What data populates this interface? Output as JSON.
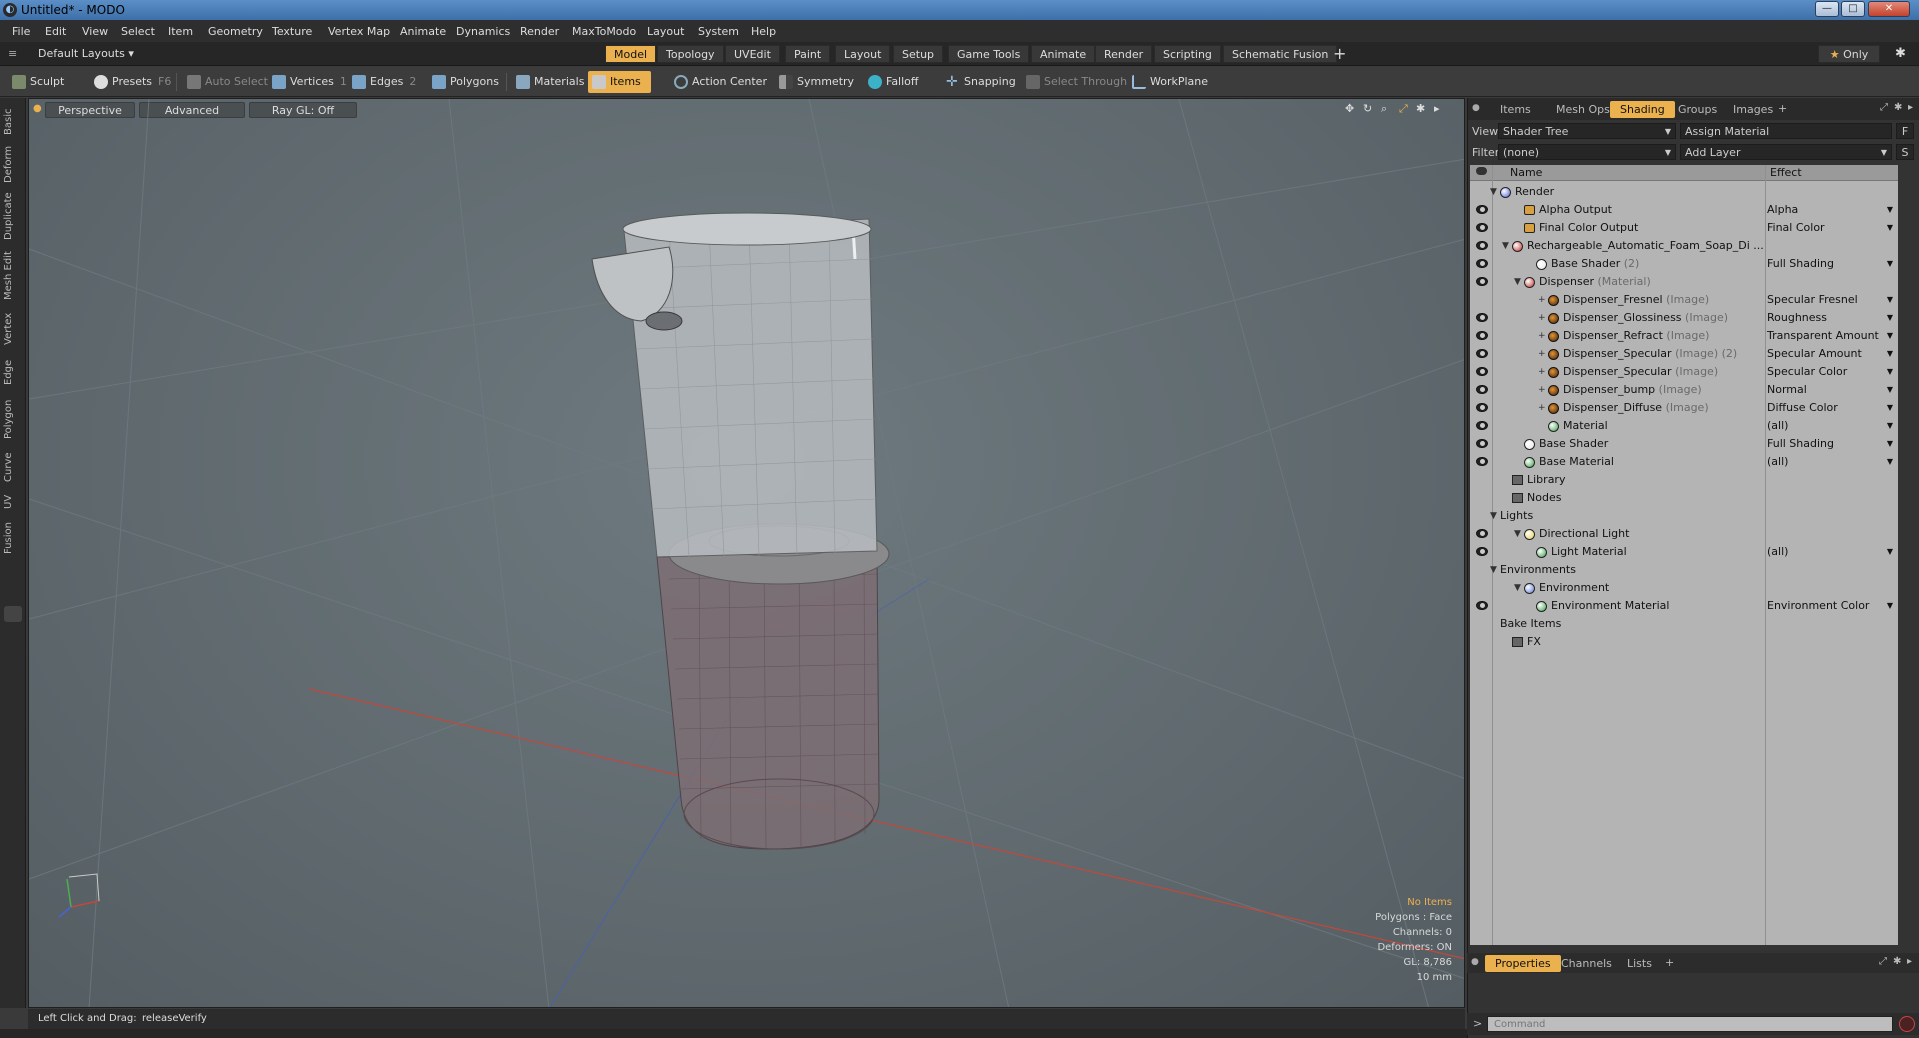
{
  "window": {
    "title": "Untitled* - MODO",
    "min": "—",
    "max": "□",
    "close": "✕"
  },
  "menu": [
    "File",
    "Edit",
    "View",
    "Select",
    "Item",
    "Geometry",
    "Texture",
    "Vertex Map",
    "Animate",
    "Dynamics",
    "Render",
    "MaxToModo",
    "Layout",
    "System",
    "Help"
  ],
  "layoutbar": {
    "layout_name": "Default Layouts",
    "tabs": [
      "Model",
      "Topology",
      "UVEdit",
      "Paint",
      "Layout",
      "Setup",
      "Game Tools",
      "Animate",
      "Render",
      "Scripting",
      "Schematic Fusion"
    ],
    "active_tab": "Model",
    "add": "+",
    "only": "Only"
  },
  "toolbar": {
    "sculpt": "Sculpt",
    "presets": "Presets",
    "presets_key": "F6",
    "auto_select": "Auto Select",
    "vertices": "Vertices",
    "vertices_key": "1",
    "edges": "Edges",
    "edges_key": "2",
    "polygons": "Polygons",
    "materials": "Materials",
    "items": "Items",
    "action_center": "Action Center",
    "symmetry": "Symmetry",
    "falloff": "Falloff",
    "snapping": "Snapping",
    "select_through": "Select Through",
    "workplane": "WorkPlane"
  },
  "left_tabs": [
    "Basic",
    "Deform",
    "Duplicate",
    "Mesh Edit",
    "Vertex",
    "Edge",
    "Polygon",
    "Curve",
    "UV",
    "Fusion"
  ],
  "viewport": {
    "perspective": "Perspective",
    "advanced": "Advanced",
    "raygl": "Ray GL: Off",
    "info": {
      "no_items": "No Items",
      "polygons": "Polygons : Face",
      "channels": "Channels: 0",
      "deformers": "Deformers: ON",
      "gl": "GL: 8,786",
      "scale": "10 mm"
    }
  },
  "status": {
    "hint": "Left Click and Drag:",
    "action": "releaseVerify"
  },
  "right_panel": {
    "tabs": [
      "Items",
      "Mesh Ops",
      "Shading",
      "Groups",
      "Images"
    ],
    "active_tab": "Shading",
    "add": "+",
    "view_label": "View",
    "view_value": "Shader Tree",
    "assign_material": "Assign Material",
    "f_btn": "F",
    "filter_label": "Filter",
    "filter_value": "(none)",
    "add_layer": "Add Layer",
    "s_btn": "S",
    "col_name": "Name",
    "col_effect": "Effect",
    "bottom_tabs": [
      "Properties",
      "Channels",
      "Lists"
    ],
    "bottom_active": "Properties",
    "command_placeholder": "Command"
  },
  "tree": [
    {
      "name": "Render",
      "suffix": "",
      "effect": "",
      "indent": 0,
      "icon": "render",
      "eye": false,
      "expand": "▼"
    },
    {
      "name": "Alpha Output",
      "suffix": "",
      "effect": "Alpha",
      "indent": 2,
      "icon": "output",
      "eye": true,
      "expand": ""
    },
    {
      "name": "Final Color Output",
      "suffix": "",
      "effect": "Final Color",
      "indent": 2,
      "icon": "output",
      "eye": true,
      "expand": ""
    },
    {
      "name": "Rechargeable_Automatic_Foam_Soap_Di ...",
      "suffix": "",
      "effect": "",
      "indent": 1,
      "icon": "group",
      "eye": true,
      "expand": "▼"
    },
    {
      "name": "Base Shader",
      "suffix": " (2)",
      "effect": "Full Shading",
      "indent": 3,
      "icon": "shader",
      "eye": true,
      "expand": ""
    },
    {
      "name": "Dispenser",
      "suffix": " (Material)",
      "effect": "",
      "indent": 2,
      "icon": "matgroup",
      "eye": true,
      "expand": "▼"
    },
    {
      "name": "Dispenser_Fresnel",
      "suffix": " (Image)",
      "effect": "Specular Fresnel",
      "indent": 4,
      "icon": "image",
      "eye": false,
      "expand": "+"
    },
    {
      "name": "Dispenser_Glossiness",
      "suffix": " (Image)",
      "effect": "Roughness",
      "indent": 4,
      "icon": "image",
      "eye": true,
      "expand": "+"
    },
    {
      "name": "Dispenser_Refract",
      "suffix": " (Image)",
      "effect": "Transparent Amount",
      "indent": 4,
      "icon": "image",
      "eye": true,
      "expand": "+"
    },
    {
      "name": "Dispenser_Specular",
      "suffix": " (Image) (2)",
      "effect": "Specular Amount",
      "indent": 4,
      "icon": "image",
      "eye": true,
      "expand": "+"
    },
    {
      "name": "Dispenser_Specular",
      "suffix": " (Image)",
      "effect": "Specular Color",
      "indent": 4,
      "icon": "image",
      "eye": true,
      "expand": "+"
    },
    {
      "name": "Dispenser_bump",
      "suffix": " (Image)",
      "effect": "Normal",
      "indent": 4,
      "icon": "image",
      "eye": true,
      "expand": "+"
    },
    {
      "name": "Dispenser_Diffuse",
      "suffix": " (Image)",
      "effect": "Diffuse Color",
      "indent": 4,
      "icon": "image",
      "eye": true,
      "expand": "+"
    },
    {
      "name": "Material",
      "suffix": "",
      "effect": "(all)",
      "indent": 4,
      "icon": "material",
      "eye": true,
      "expand": ""
    },
    {
      "name": "Base Shader",
      "suffix": "",
      "effect": "Full Shading",
      "indent": 2,
      "icon": "shader",
      "eye": true,
      "expand": ""
    },
    {
      "name": "Base Material",
      "suffix": "",
      "effect": "(all)",
      "indent": 2,
      "icon": "material",
      "eye": true,
      "expand": ""
    },
    {
      "name": "Library",
      "suffix": "",
      "effect": "",
      "indent": 1,
      "icon": "folder",
      "eye": false,
      "expand": ""
    },
    {
      "name": "Nodes",
      "suffix": "",
      "effect": "",
      "indent": 1,
      "icon": "folder",
      "eye": false,
      "expand": ""
    },
    {
      "name": "Lights",
      "suffix": "",
      "effect": "",
      "indent": 0,
      "icon": "",
      "eye": false,
      "expand": "▼"
    },
    {
      "name": "Directional Light",
      "suffix": "",
      "effect": "",
      "indent": 2,
      "icon": "light",
      "eye": true,
      "expand": "▼"
    },
    {
      "name": "Light Material",
      "suffix": "",
      "effect": "(all)",
      "indent": 3,
      "icon": "material",
      "eye": true,
      "expand": ""
    },
    {
      "name": "Environments",
      "suffix": "",
      "effect": "",
      "indent": 0,
      "icon": "",
      "eye": false,
      "expand": "▼"
    },
    {
      "name": "Environment",
      "suffix": "",
      "effect": "",
      "indent": 2,
      "icon": "env",
      "eye": false,
      "expand": "▼"
    },
    {
      "name": "Environment Material",
      "suffix": "",
      "effect": "Environment Color",
      "indent": 3,
      "icon": "material",
      "eye": true,
      "expand": ""
    },
    {
      "name": "Bake Items",
      "suffix": "",
      "effect": "",
      "indent": 0,
      "icon": "",
      "eye": false,
      "expand": ""
    },
    {
      "name": "FX",
      "suffix": "",
      "effect": "",
      "indent": 1,
      "icon": "fx",
      "eye": false,
      "expand": ""
    }
  ],
  "colors": {
    "accent": "#ecb14f",
    "viewport_bg": "#626c71",
    "tree_bg": "#b4b4b4"
  }
}
